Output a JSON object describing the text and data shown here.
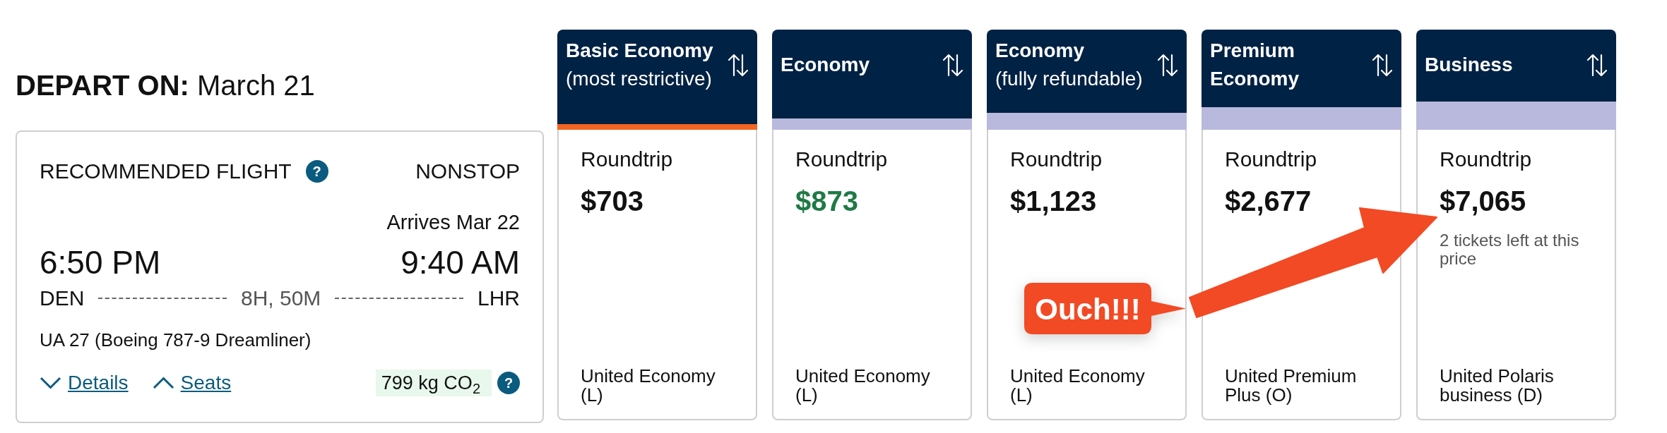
{
  "departure": {
    "heading": "**DEPART ON:** March 21"
  },
  "flight_card": {
    "label": "RECOMMENDED FLIGHT",
    "label_help": "?",
    "stops": "NONSTOP",
    "arrival_note": "Arrives Mar 22",
    "departure_time": "6:50 PM",
    "arrival_time": "9:40 AM",
    "origin": "DEN",
    "duration": "8H, 50M",
    "destination": "LHR",
    "flight": "UA 27 (Boeing 787-9 Dreamliner)",
    "links": [
      {
        "label": "Details",
        "expanded": false
      },
      {
        "label": "Seats",
        "expanded": true
      }
    ],
    "emissions": "799 kg CO$_{2}$",
    "emissions_help": "?"
  },
  "fare_columns": [
    {
      "title": "Basic Economy",
      "subtitle": "(most restrictive)",
      "selected": true,
      "trip": "Roundtrip",
      "price": "$703",
      "highlighted": false,
      "fare_class": "United Economy (L)"
    },
    {
      "title": "Economy",
      "selected": false,
      "trip": "Roundtrip",
      "price": "$873",
      "highlighted": true,
      "fare_class": "United Economy (L)"
    },
    {
      "title": "Economy",
      "subtitle": "(fully refundable)",
      "selected": false,
      "trip": "Roundtrip",
      "price": "$1,123",
      "highlighted": false,
      "fare_class": "United Economy (L)"
    },
    {
      "title": "Premium Economy",
      "selected": false,
      "trip": "Roundtrip",
      "price": "$2,677",
      "highlighted": false,
      "fare_class": "United Premium Plus (O)"
    },
    {
      "title": "Business",
      "selected": false,
      "trip": "Roundtrip",
      "price": "$7,065",
      "highlighted": false,
      "note": "2 tickets left at this price",
      "fare_class": "United Polaris business (D)"
    }
  ],
  "callout": {
    "text": "Ouch!!!"
  }
}
